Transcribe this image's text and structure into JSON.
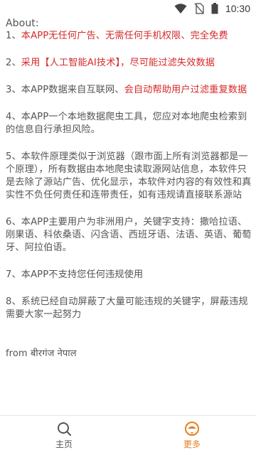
{
  "status_bar": {
    "time": "10:30"
  },
  "about": {
    "title": "About:",
    "paragraphs": [
      {
        "prefix": "1、",
        "highlight": "本APP无任何广告、无需任何手机权限、完全免费",
        "rest": ""
      },
      {
        "prefix": "2、",
        "highlight": "采用【人工智能AI技术】，尽可能过滤失效数据",
        "rest": ""
      },
      {
        "prefix": "3、本APP数据来自互联网、",
        "highlight": "会自动帮助用户过滤重复数据",
        "rest": ""
      },
      {
        "prefix": "4、本APP一个本地数据爬虫工具，您应对本地爬虫检索到的信息自行承担风险。",
        "highlight": "",
        "rest": ""
      },
      {
        "prefix": "5、本软件原理类似于浏览器（跟市面上所有浏览器都是一个原理），所有数据由本地爬虫读取源网站信息，本软件只是去除了源站广告、优化显示，本软件对内容的有效性和真实性不负任何责任和连带责任，如有违规请直接联系源站",
        "highlight": "",
        "rest": ""
      },
      {
        "prefix": "6、本APP主要用户为非洲用户，关键字支持：撒哈拉语、刚果语、科依桑语、闪含语、西班牙语、法语、英语、葡萄牙、阿拉伯语。",
        "highlight": "",
        "rest": ""
      },
      {
        "prefix": "7、本APP不支持您任何违规使用",
        "highlight": "",
        "rest": ""
      },
      {
        "prefix": "8、系统已经自动屏蔽了大量可能违规的关键字，屏蔽违规需要大家一起努力",
        "highlight": "",
        "rest": ""
      }
    ],
    "footer": "from बीरगंज नेपाल"
  },
  "tabbar": {
    "home_label": "主页",
    "more_label": "更多",
    "home_icon": "search-icon",
    "more_icon": "more-icon",
    "active_color": "#e67e22"
  },
  "colors": {
    "highlight": "#d62b2b",
    "text": "#555555"
  }
}
